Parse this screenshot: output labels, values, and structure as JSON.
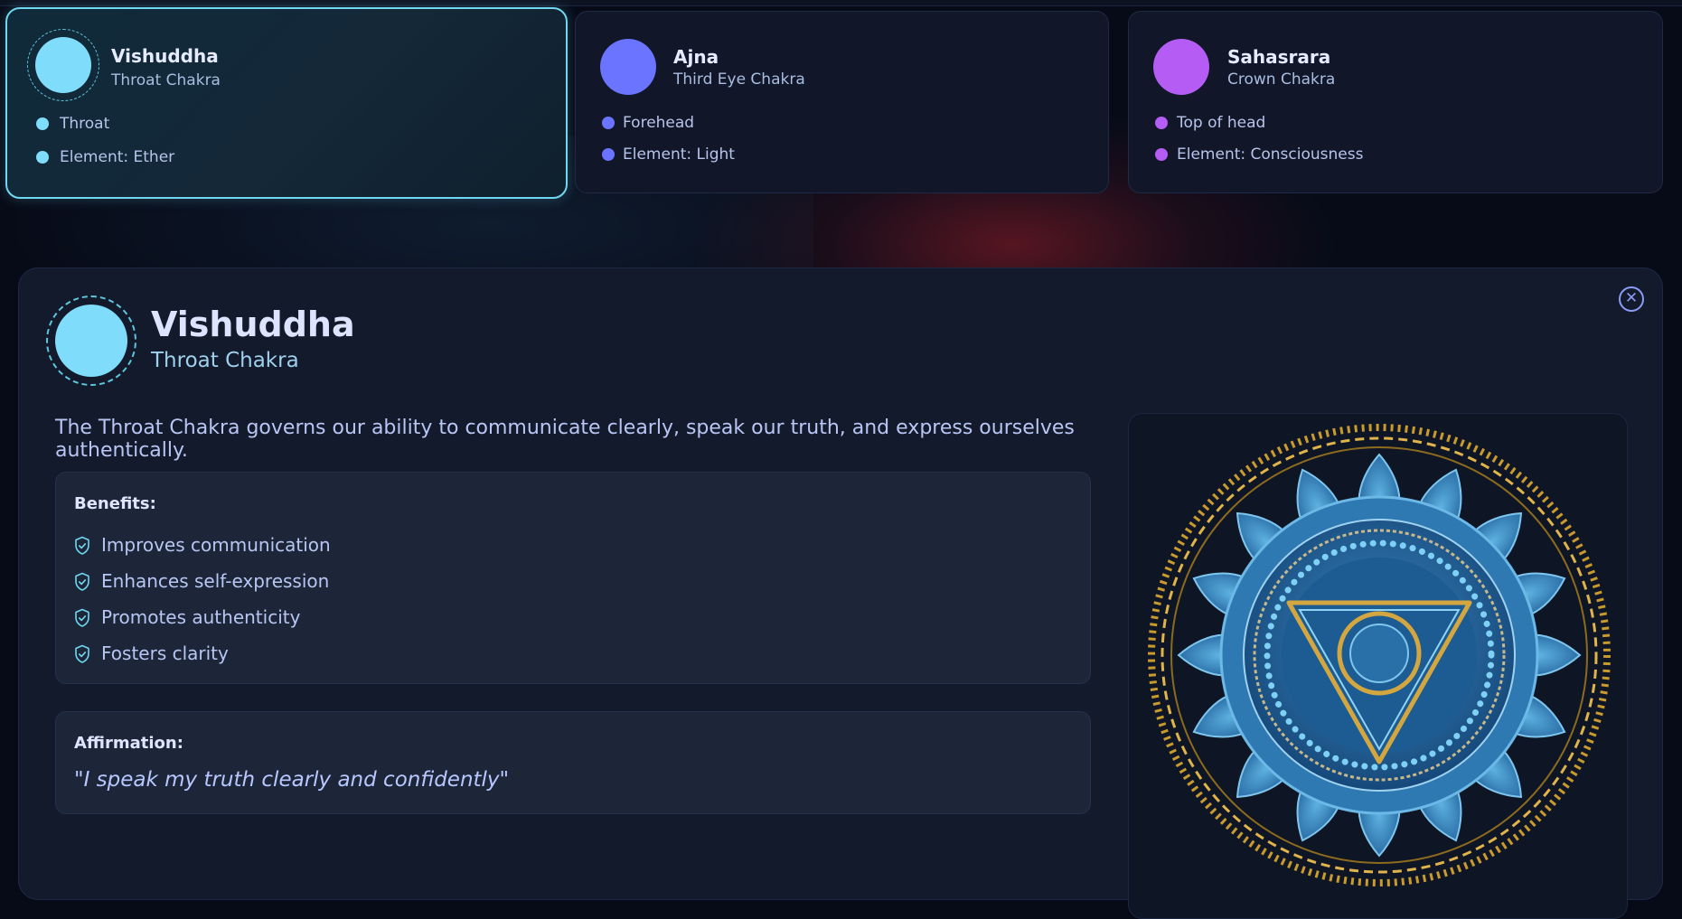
{
  "colors": {
    "throat": "#7fdcfb",
    "third_eye": "#6a74ff",
    "crown": "#b55cf5",
    "accent_border": "#6fd8f0"
  },
  "cards": [
    {
      "name": "Vishuddha",
      "subtitle": "Throat Chakra",
      "attrs": [
        "Throat",
        "Element: Ether"
      ]
    },
    {
      "name": "Ajna",
      "subtitle": "Third Eye Chakra",
      "attrs": [
        "Forehead",
        "Element: Light"
      ]
    },
    {
      "name": "Sahasrara",
      "subtitle": "Crown Chakra",
      "attrs": [
        "Top of head",
        "Element: Consciousness"
      ]
    }
  ],
  "detail": {
    "title": "Vishuddha",
    "subtitle": "Throat Chakra",
    "close_icon": "close-circle-icon",
    "description": "The Throat Chakra governs our ability to communicate clearly, speak our truth, and express ourselves authentically.",
    "benefits_label": "Benefits:",
    "benefit_icon": "shield-check-icon",
    "benefits": [
      "Improves communication",
      "Enhances self-expression",
      "Promotes authenticity",
      "Fosters clarity"
    ],
    "affirmation_label": "Affirmation:",
    "affirmation": "\"I speak my truth clearly and confidently\""
  }
}
